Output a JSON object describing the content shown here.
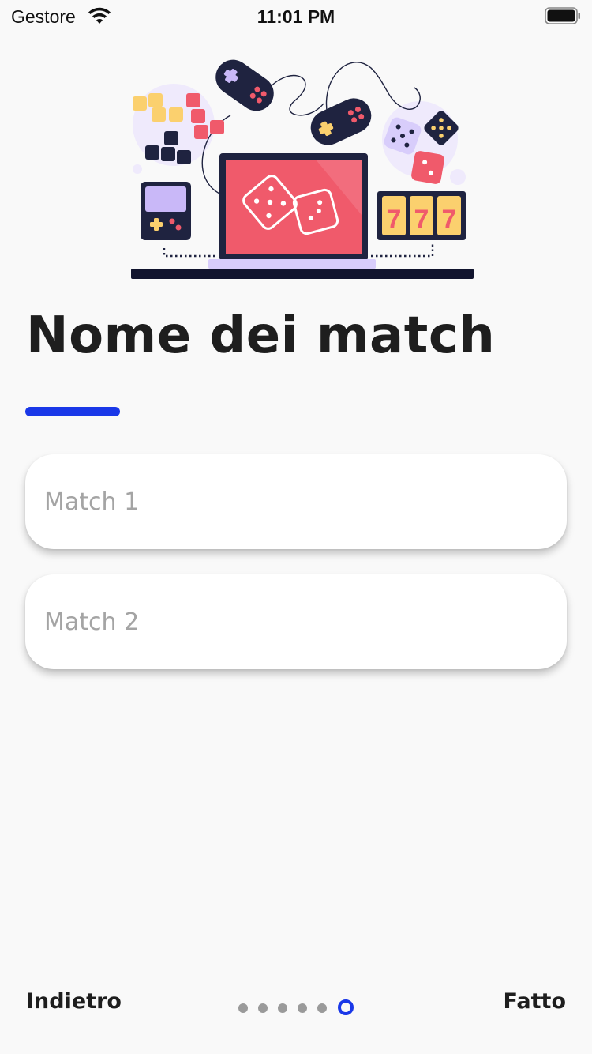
{
  "status_bar": {
    "carrier": "Gestore",
    "time": "11:01 PM"
  },
  "illustration": {
    "slot_text": "777"
  },
  "title": "Nome dei match",
  "fields": [
    {
      "placeholder": "Match 1",
      "value": ""
    },
    {
      "placeholder": "Match 2",
      "value": ""
    }
  ],
  "nav": {
    "back_label": "Indietro",
    "done_label": "Fatto",
    "page_count": 6,
    "current_page": 6
  },
  "colors": {
    "accent": "#1a38e8",
    "background": "#f9f9f9"
  }
}
